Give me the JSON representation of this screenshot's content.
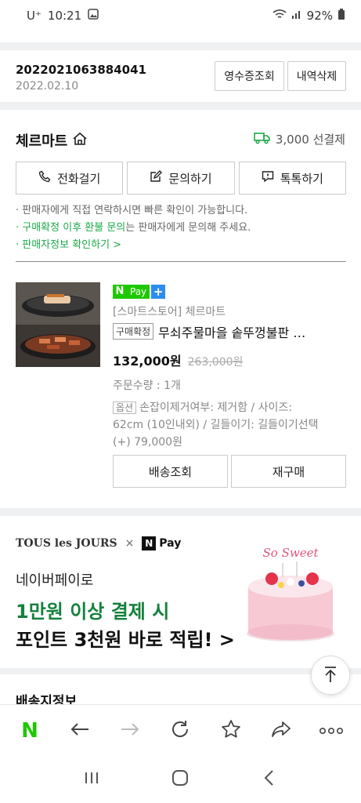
{
  "status_bar": {
    "carrier": "U⁺",
    "time": "10:21",
    "battery": "92%"
  },
  "order": {
    "id": "2022021063884041",
    "date": "2022.02.10",
    "receipt_label": "영수증조회",
    "delete_label": "내역삭제"
  },
  "seller": {
    "name": "체르마트",
    "shipping_text": "3,000 선결제",
    "call_label": "전화걸기",
    "inquiry_label": "문의하기",
    "talk_label": "톡톡하기",
    "note1": "· 판매자에게 직접 연락하시면 빠른 확인이 가능합니다.",
    "note2_green": "· 구매확정 이후 환불 문의",
    "note2_rest": "는 판매자에게 문의해 주세요.",
    "note3": "· 판매자정보 확인하기 >"
  },
  "product": {
    "npay_n": "N",
    "npay_pay": "Pay",
    "npay_plus": "+",
    "store": "[스마트스토어] 체르마트",
    "status_badge": "구매확정",
    "title": "무쇠주물마을 솥뚜껑불판 …",
    "price": "132,000원",
    "original_price": "263,000원",
    "quantity": "주문수량 : 1개",
    "option_badge": "옵션",
    "options_line1": "손잡이제거여부: 제거함 / 사이즈:",
    "options_line2": "62cm (10인내외) / 길들이기: 길들이기선택",
    "options_line3": "(+) 79,000원",
    "track_label": "배송조회",
    "reorder_label": "재구매"
  },
  "banner": {
    "brand": "TOUS les JOURS",
    "times": "×",
    "pay_n": "N",
    "pay_text": "Pay",
    "sub": "네이버페이로",
    "line1": "1만원 이상 결제 시",
    "line2": "포인트 3천원 바로 적립! >",
    "cake_text": "So Sweet",
    "accent_green": "#14813c"
  },
  "shipping_section_title": "배송지정보",
  "browser": {
    "home_label": "N"
  }
}
